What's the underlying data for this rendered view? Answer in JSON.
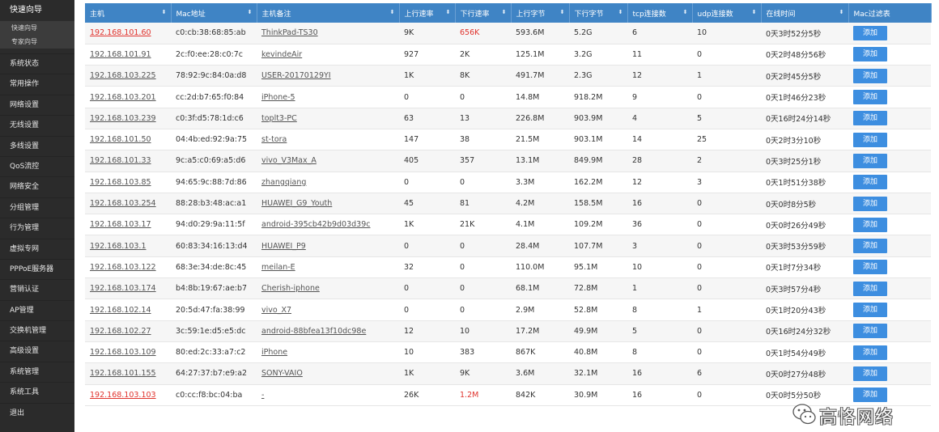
{
  "sidebar": {
    "top_item": "快速向导",
    "sub_items": [
      "快速向导",
      "专家向导"
    ],
    "items": [
      "系统状态",
      "常用操作",
      "网络设置",
      "无线设置",
      "多线设置",
      "QoS流控",
      "网络安全",
      "分组管理",
      "行为管理",
      "虚拟专网",
      "PPPoE服务器",
      "营销认证",
      "AP管理",
      "交换机管理",
      "高级设置",
      "系统管理",
      "系统工具",
      "退出"
    ]
  },
  "table": {
    "columns": [
      "主机",
      "Mac地址",
      "主机备注",
      "上行速率",
      "下行速率",
      "上行字节",
      "下行字节",
      "tcp连接数",
      "udp连接数",
      "在线时间",
      "Mac过滤表"
    ],
    "sort_icon": "sort-arrows-icon",
    "button_label": "添加",
    "rows": [
      {
        "host": "192.168.101.60",
        "mac": "c0:cb:38:68:85:ab",
        "alias": "ThinkPad-TS30",
        "up": "9K",
        "down": "656K",
        "upb": "593.6M",
        "downb": "5.2G",
        "tcp": "6",
        "udp": "10",
        "time": "0天3时52分5秒",
        "host_red": true,
        "down_red": true
      },
      {
        "host": "192.168.101.91",
        "mac": "2c:f0:ee:28:c0:7c",
        "alias": "kevindeAir",
        "up": "927",
        "down": "2K",
        "upb": "125.1M",
        "downb": "3.2G",
        "tcp": "11",
        "udp": "0",
        "time": "0天2时48分56秒",
        "host_red": false,
        "down_red": false
      },
      {
        "host": "192.168.103.225",
        "mac": "78:92:9c:84:0a:d8",
        "alias": "USER-20170129YI",
        "up": "1K",
        "down": "8K",
        "upb": "491.7M",
        "downb": "2.3G",
        "tcp": "12",
        "udp": "1",
        "time": "0天2时45分5秒",
        "host_red": false,
        "down_red": false
      },
      {
        "host": "192.168.103.201",
        "mac": "cc:2d:b7:65:f0:84",
        "alias": "iPhone-5",
        "up": "0",
        "down": "0",
        "upb": "14.8M",
        "downb": "918.2M",
        "tcp": "9",
        "udp": "0",
        "time": "0天1时46分23秒",
        "host_red": false,
        "down_red": false
      },
      {
        "host": "192.168.103.239",
        "mac": "c0:3f:d5:78:1d:c6",
        "alias": "toplt3-PC",
        "up": "63",
        "down": "13",
        "upb": "226.8M",
        "downb": "903.9M",
        "tcp": "4",
        "udp": "5",
        "time": "0天16时24分14秒",
        "host_red": false,
        "down_red": false
      },
      {
        "host": "192.168.101.50",
        "mac": "04:4b:ed:92:9a:75",
        "alias": "st-tora",
        "up": "147",
        "down": "38",
        "upb": "21.5M",
        "downb": "903.1M",
        "tcp": "14",
        "udp": "25",
        "time": "0天2时3分10秒",
        "host_red": false,
        "down_red": false
      },
      {
        "host": "192.168.101.33",
        "mac": "9c:a5:c0:69:a5:d6",
        "alias": "vivo_V3Max_A",
        "up": "405",
        "down": "357",
        "upb": "13.1M",
        "downb": "849.9M",
        "tcp": "28",
        "udp": "2",
        "time": "0天3时25分1秒",
        "host_red": false,
        "down_red": false
      },
      {
        "host": "192.168.103.85",
        "mac": "94:65:9c:88:7d:86",
        "alias": "zhangqiang",
        "up": "0",
        "down": "0",
        "upb": "3.3M",
        "downb": "162.2M",
        "tcp": "12",
        "udp": "3",
        "time": "0天1时51分38秒",
        "host_red": false,
        "down_red": false
      },
      {
        "host": "192.168.103.254",
        "mac": "88:28:b3:48:ac:a1",
        "alias": "HUAWEI_G9_Youth",
        "up": "45",
        "down": "81",
        "upb": "4.2M",
        "downb": "158.5M",
        "tcp": "16",
        "udp": "0",
        "time": "0天0时8分5秒",
        "host_red": false,
        "down_red": false
      },
      {
        "host": "192.168.103.17",
        "mac": "94:d0:29:9a:11:5f",
        "alias": "android-395cb42b9d03d39c",
        "up": "1K",
        "down": "21K",
        "upb": "4.1M",
        "downb": "109.2M",
        "tcp": "36",
        "udp": "0",
        "time": "0天0时26分49秒",
        "host_red": false,
        "down_red": false
      },
      {
        "host": "192.168.103.1",
        "mac": "60:83:34:16:13:d4",
        "alias": "HUAWEI_P9",
        "up": "0",
        "down": "0",
        "upb": "28.4M",
        "downb": "107.7M",
        "tcp": "3",
        "udp": "0",
        "time": "0天3时53分59秒",
        "host_red": false,
        "down_red": false
      },
      {
        "host": "192.168.103.122",
        "mac": "68:3e:34:de:8c:45",
        "alias": "meilan-E",
        "up": "32",
        "down": "0",
        "upb": "110.0M",
        "downb": "95.1M",
        "tcp": "10",
        "udp": "0",
        "time": "0天1时7分34秒",
        "host_red": false,
        "down_red": false
      },
      {
        "host": "192.168.103.174",
        "mac": "b4:8b:19:67:ae:b7",
        "alias": "Cherish-iphone",
        "up": "0",
        "down": "0",
        "upb": "68.1M",
        "downb": "72.8M",
        "tcp": "1",
        "udp": "0",
        "time": "0天3时57分4秒",
        "host_red": false,
        "down_red": false
      },
      {
        "host": "192.168.102.14",
        "mac": "20:5d:47:fa:38:99",
        "alias": "vivo_X7",
        "up": "0",
        "down": "0",
        "upb": "2.9M",
        "downb": "52.8M",
        "tcp": "8",
        "udp": "1",
        "time": "0天1时20分43秒",
        "host_red": false,
        "down_red": false
      },
      {
        "host": "192.168.102.27",
        "mac": "3c:59:1e:d5:e5:dc",
        "alias": "android-88bfea13f10dc98e",
        "up": "12",
        "down": "10",
        "upb": "17.2M",
        "downb": "49.9M",
        "tcp": "5",
        "udp": "0",
        "time": "0天16时24分32秒",
        "host_red": false,
        "down_red": false
      },
      {
        "host": "192.168.103.109",
        "mac": "80:ed:2c:33:a7:c2",
        "alias": "iPhone",
        "up": "10",
        "down": "383",
        "upb": "867K",
        "downb": "40.8M",
        "tcp": "8",
        "udp": "0",
        "time": "0天1时54分49秒",
        "host_red": false,
        "down_red": false
      },
      {
        "host": "192.168.101.155",
        "mac": "64:27:37:b7:e9:a2",
        "alias": "SONY-VAIO",
        "up": "1K",
        "down": "9K",
        "upb": "3.6M",
        "downb": "32.1M",
        "tcp": "16",
        "udp": "6",
        "time": "0天0时27分48秒",
        "host_red": false,
        "down_red": false
      },
      {
        "host": "192.168.103.103",
        "mac": "c0:cc:f8:bc:04:ba",
        "alias": "-",
        "up": "26K",
        "down": "1.2M",
        "upb": "842K",
        "downb": "30.9M",
        "tcp": "16",
        "udp": "0",
        "time": "0天0时5分50秒",
        "host_red": true,
        "down_red": true
      }
    ]
  },
  "watermark": {
    "text": "高恪网络",
    "icon": "wechat-icon"
  }
}
